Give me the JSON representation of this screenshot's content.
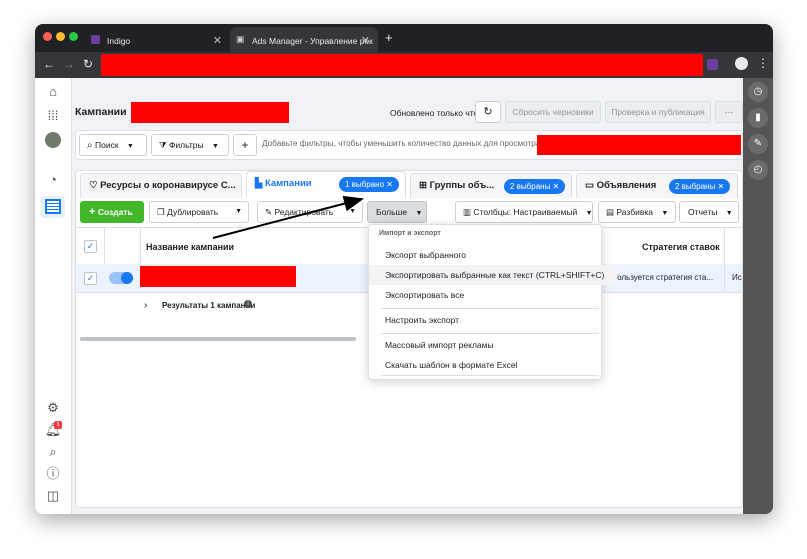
{
  "browser": {
    "tabs": [
      {
        "title": "Indigo"
      },
      {
        "title": "Ads Manager - Управление рек"
      }
    ],
    "new_tab_label": "+",
    "ext_badge": "2"
  },
  "header": {
    "title": "Кампании",
    "updated_text": "Обновлено только что",
    "discard_label": "Сбросить черновики",
    "review_label": "Проверка и публикация",
    "more_label": "···"
  },
  "filters": {
    "search_label": "Поиск",
    "filters_label": "Фильтры",
    "add_label": "+",
    "placeholder": "Добавьте фильтры, чтобы уменьшить количество данных для просмотра."
  },
  "level_tabs": {
    "corona": "Ресурсы о коронавирусе С...",
    "campaigns": "Кампании",
    "campaigns_pill": "1 выбрано",
    "adsets": "Группы объ...",
    "adsets_pill": "2 выбраны",
    "ads": "Объявления",
    "ads_pill": "2 выбраны"
  },
  "actions": {
    "create": "Создать",
    "duplicate": "Дублировать",
    "edit": "Редактировать",
    "more": "Больше",
    "columns": "Столбцы: Настраиваемый",
    "breakdown": "Разбивка",
    "reports": "Отчеты"
  },
  "table": {
    "col_name": "Название кампании",
    "col_strategy": "Стратегия ставок",
    "row_strategy": "Используется стратегия ста...",
    "row_extra": "Ис",
    "results": "Результаты 1 кампании"
  },
  "menu": {
    "section": "Импорт и экспорт",
    "items": [
      "Экспорт выбранного",
      "Экспортировать выбранные как текст (CTRL+SHIFT+C)",
      "Экспортировать все",
      "Настроить экспорт",
      "Массовый импорт рекламы",
      "Скачать шаблон в формате Excel"
    ]
  },
  "sidebar": {
    "notification_count": "1"
  },
  "colors": {
    "accent": "#1877f2",
    "create": "#42b72a",
    "redaction": "#ff0000"
  }
}
